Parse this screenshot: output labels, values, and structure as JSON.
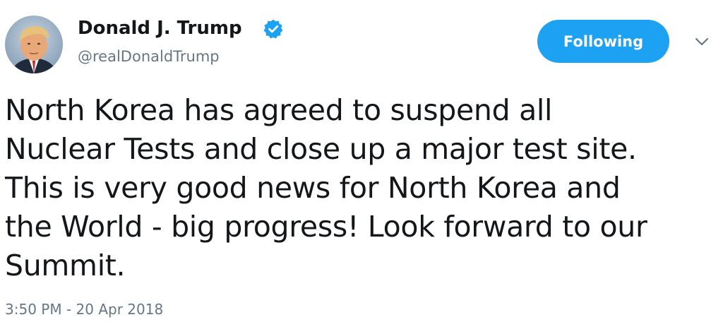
{
  "tweet": {
    "author": {
      "display_name": "Donald J. Trump",
      "handle": "@realDonaldTrump",
      "verified": true,
      "avatar_icon": "profile-photo"
    },
    "follow_button": {
      "label": "Following",
      "color": "#1da1f2"
    },
    "menu_icon": "chevron-down-icon",
    "text_lines": [
      "North Korea has agreed to suspend all",
      "Nuclear Tests and close up a major test site.",
      "This is very good news for North Korea and",
      "the World - big progress! Look forward to our",
      "Summit."
    ],
    "timestamp": "3:50 PM - 20 Apr 2018"
  },
  "colors": {
    "text": "#14171a",
    "secondary": "#657786",
    "accent": "#1da1f2"
  }
}
